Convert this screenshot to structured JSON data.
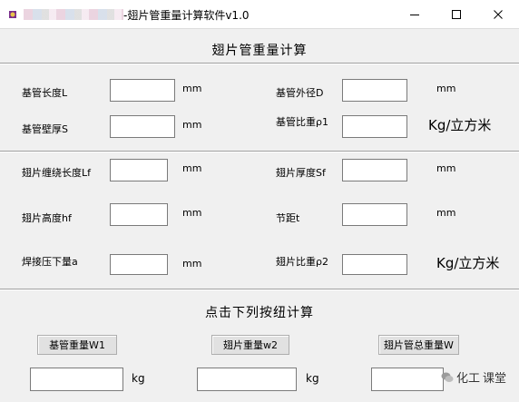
{
  "window": {
    "title": "-翅片管重量计算软件v1.0",
    "icons": {
      "app": "app-icon",
      "minimize": "minimize-icon",
      "maximize": "maximize-icon",
      "close": "close-icon"
    }
  },
  "section1": {
    "header": "翅片管重量计算",
    "fields": {
      "base_length": {
        "label": "基管长度L",
        "unit": "mm",
        "value": ""
      },
      "base_outer_d": {
        "label": "基管外径D",
        "unit": "mm",
        "value": ""
      },
      "base_wall": {
        "label": "基管壁厚S",
        "unit": "mm",
        "value": ""
      },
      "base_density": {
        "label": "基管比重ρ1",
        "unit": "Kg/立方米",
        "value": ""
      }
    }
  },
  "section2": {
    "fields": {
      "fin_length": {
        "label": "翅片缠绕长度Lf",
        "unit": "mm",
        "value": ""
      },
      "fin_thickness": {
        "label": "翅片厚度Sf",
        "unit": "mm",
        "value": ""
      },
      "fin_height": {
        "label": "翅片高度hf",
        "unit": "mm",
        "value": ""
      },
      "pitch": {
        "label": "节距t",
        "unit": "mm",
        "value": ""
      },
      "weld_press": {
        "label": "焊接压下量a",
        "unit": "mm",
        "value": ""
      },
      "fin_density": {
        "label": "翅片比重ρ2",
        "unit": "Kg/立方米",
        "value": ""
      }
    }
  },
  "section3": {
    "header": "点击下列按纽计算",
    "buttons": {
      "base_weight": "基管重量W1",
      "fin_weight": "翅片重量w2",
      "total_weight": "翅片管总重量W"
    },
    "results": {
      "base_weight": {
        "value": "",
        "unit": "kg"
      },
      "fin_weight": {
        "value": "",
        "unit": "kg"
      },
      "total_weight": {
        "value": ""
      }
    }
  },
  "watermark": {
    "text": "化工",
    "text_tail": "课堂",
    "icon": "wechat-icon"
  }
}
